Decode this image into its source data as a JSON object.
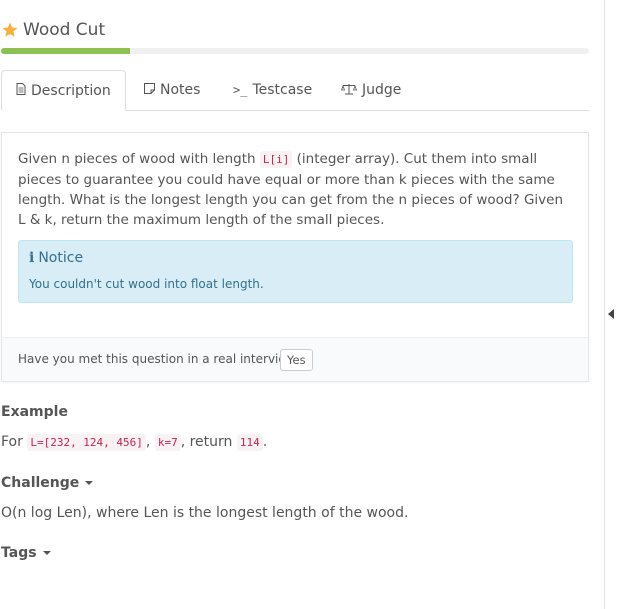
{
  "problem": {
    "title": "Wood Cut",
    "progress_fraction": 0.22
  },
  "tabs": [
    {
      "label": "Description",
      "icon": "file-icon"
    },
    {
      "label": "Notes",
      "icon": "note-icon"
    },
    {
      "label": "Testcase",
      "icon": "terminal-icon"
    },
    {
      "label": "Judge",
      "icon": "scale-icon"
    }
  ],
  "description": {
    "text_1": "Given n pieces of wood with length ",
    "code_1": "L[i]",
    "text_2": " (integer array). Cut them into small pieces to guarantee you could have equal or more than k pieces with the same length. What is the longest length you can get from the n pieces of wood? Given L & k, return the maximum length of the small pieces."
  },
  "notice": {
    "title": "Notice",
    "text": "You couldn't cut wood into float length."
  },
  "interview": {
    "question": "Have you met this question in a real interview?",
    "yes_label": "Yes"
  },
  "example": {
    "heading": "Example",
    "prefix": "For ",
    "code_L": "L=[232, 124, 456]",
    "sep": ", ",
    "code_k": "k=7",
    "mid": ", return ",
    "code_result": "114",
    "suffix": "."
  },
  "challenge": {
    "heading": "Challenge",
    "text": "O(n log Len), where Len is the longest length of the wood."
  },
  "tags": {
    "heading": "Tags"
  },
  "colors": {
    "progress": "#8cc152",
    "notice_bg": "#d9edf7",
    "notice_text": "#31708f",
    "code_text": "#c7254e",
    "star": "#f5b041"
  }
}
